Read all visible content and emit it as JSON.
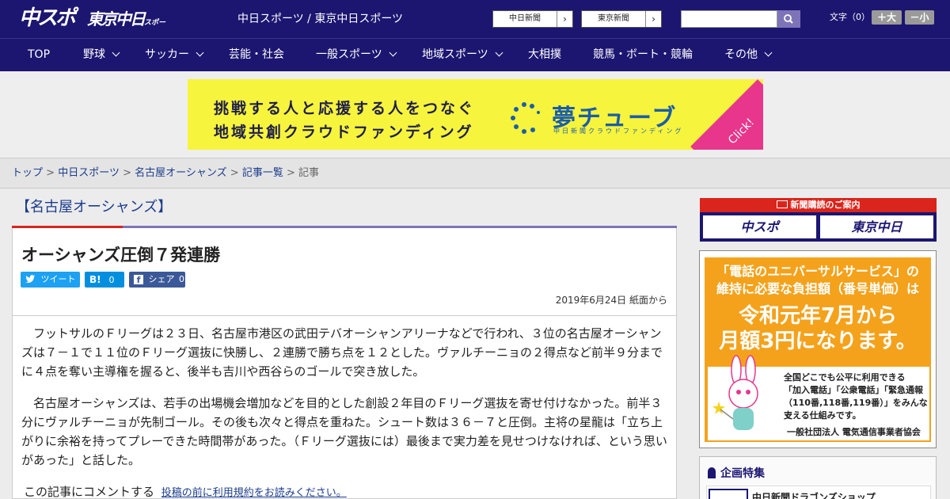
{
  "header": {
    "logo_chunichi_sports": "中スポ",
    "logo_tokyo_chunichi": "東京中日",
    "logo_tokyo_chunichi_small": "スポーツ",
    "site_name": "中日スポーツ / 東京中日スポーツ",
    "ext_links": [
      {
        "label": "中日新聞",
        "arrow": "›"
      },
      {
        "label": "東京新聞",
        "arrow": "›"
      }
    ],
    "search": {
      "placeholder": "",
      "value": ""
    },
    "font_size_label": "文字（0）",
    "font_larger": "＋大",
    "font_smaller": "－小"
  },
  "nav": {
    "items": [
      {
        "label": "TOP",
        "dropdown": false
      },
      {
        "label": "野球",
        "dropdown": true
      },
      {
        "label": "サッカー",
        "dropdown": true
      },
      {
        "label": "芸能・社会",
        "dropdown": false
      },
      {
        "label": "一般スポーツ",
        "dropdown": true
      },
      {
        "label": "地域スポーツ",
        "dropdown": true
      },
      {
        "label": "大相撲",
        "dropdown": false
      },
      {
        "label": "競馬・ボート・競輪",
        "dropdown": false
      },
      {
        "label": "その他",
        "dropdown": true
      }
    ]
  },
  "banner": {
    "line1": "挑戦する人と応援する人をつなぐ",
    "line2": "地域共創クラウドファンディング",
    "brand": "夢チューブ",
    "brand_sub": "中日新聞クラウドファンディング",
    "click": "Click!"
  },
  "breadcrumb": {
    "items": [
      "トップ",
      "中日スポーツ",
      "名古屋オーシャンズ",
      "記事一覧"
    ],
    "current": "記事",
    "sep": ">"
  },
  "article": {
    "category": "【名古屋オーシャンズ】",
    "title": "オーシャンズ圧倒７発連勝",
    "share": {
      "tweet": "ツイート",
      "hatena": "B!",
      "hatena_count": "0",
      "facebook": "シェア",
      "facebook_count": "0"
    },
    "date": "2019年6月24日 紙面から",
    "paragraphs": [
      "フットサルのＦリーグは２３日、名古屋市港区の武田テバオーシャンアリーナなどで行われ、３位の名古屋オーシャンズは７－１で１１位のＦリーグ選抜に快勝し、２連勝で勝ち点を１２とした。ヴァルチーニョの２得点など前半９分までに４点を奪い主導権を握ると、後半も吉川や西谷らのゴールで突き放した。",
      "名古屋オーシャンズは、若手の出場機会増加などを目的とした創設２年目のＦリーグ選抜を寄せ付けなかった。前半３分にヴァルチーニョが先制ゴール。その後も次々と得点を重ねた。シュート数は３６－７と圧倒。主将の星龍は「立ち上がりに余裕を持ってプレーできた時間帯があった。（Ｆリーグ選抜には）最後まで実力差を見せつけなければ、という思いがあった」と話した。"
    ],
    "comment_prompt": "この記事にコメントする",
    "comment_link": "投稿の前に利用規約をお読みください。"
  },
  "sidebar": {
    "subscribe_title": "新聞購読のご案内",
    "subscribe_btn1": "中スポ",
    "subscribe_btn2": "東京中日",
    "ad": {
      "headline1": "「電話のユニバーサルサービス」の",
      "headline2": "維持に必要な負担額（番号単価）は",
      "big1": "令和元年7月から",
      "big2": "月額3円になります。",
      "body1": "全国どこでも公平に利用できる",
      "body2": "「加入電話」「公衆電話」「緊急通報",
      "body3": "（110番,118番,119番）」をみんなで",
      "body4": "支える仕組みです。",
      "org": "一般社団法人 電気通信事業者協会"
    },
    "feature_title": "企画特集",
    "feature_item": "中日新聞ドラゴンズショップ"
  },
  "colors": {
    "brand_navy": "#1c1671",
    "accent_purple": "#7d74b8",
    "accent_red": "#d9251c",
    "banner_yellow": "#f7f43d",
    "ad_orange": "#f4a21c",
    "twitter": "#1da1f2",
    "hatena": "#008fde",
    "facebook": "#3b5998"
  },
  "icons": [
    "search-icon",
    "chevron-down-icon",
    "twitter-icon",
    "facebook-icon",
    "newspaper-icon",
    "ribbon-icon"
  ]
}
